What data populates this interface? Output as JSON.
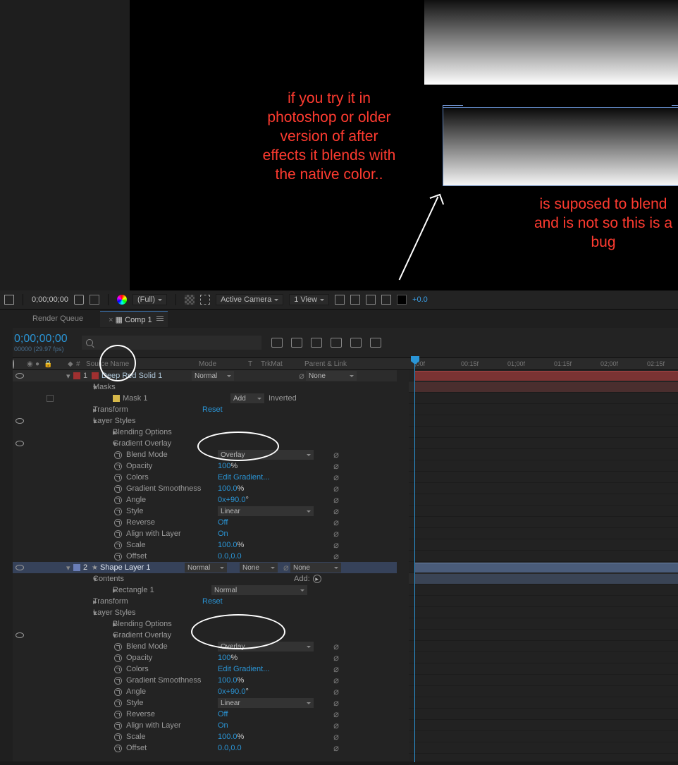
{
  "annotations": {
    "text1": "if you try it in photoshop or older version of after effects it blends with the native color..",
    "text2": "is suposed to blend and is not so this is a bug"
  },
  "toolbar": {
    "time": "0;00;00;00",
    "resolution": "(Full)",
    "camera": "Active Camera",
    "views": "1 View",
    "exposure": "+0.0"
  },
  "tabs": {
    "render_queue": "Render Queue",
    "comp": "Comp 1"
  },
  "timecode": {
    "main": "0;00;00;00",
    "sub": "00000 (29.97 fps)"
  },
  "ruler": {
    "marks": [
      ";00f",
      "00:15f",
      "01;00f",
      "01:15f",
      "02;00f",
      "02:15f"
    ]
  },
  "headers": {
    "source_name": "Source Name",
    "mode": "Mode",
    "t": "T",
    "trkmat": "TrkMat",
    "parent": "Parent & Link"
  },
  "layer1": {
    "num": "1",
    "name": "Deep Red Solid 1",
    "mode": "Normal",
    "parent": "None",
    "masks": "Masks",
    "mask1": "Mask 1",
    "mask_mode": "Add",
    "mask_inverted": "Inverted",
    "transform": "Transform",
    "transform_reset": "Reset",
    "layer_styles": "Layer Styles",
    "blending_options": "Blending Options",
    "gradient_overlay": "Gradient Overlay",
    "props": {
      "blend_mode": {
        "label": "Blend Mode",
        "value": "Overlay"
      },
      "opacity": {
        "label": "Opacity",
        "value": "100",
        "suffix": "%"
      },
      "colors": {
        "label": "Colors",
        "value": "Edit Gradient..."
      },
      "gradient_smoothness": {
        "label": "Gradient Smoothness",
        "value": "100.0",
        "suffix": "%"
      },
      "angle": {
        "label": "Angle",
        "value": "0x+90.0",
        "suffix": "°"
      },
      "style": {
        "label": "Style",
        "value": "Linear"
      },
      "reverse": {
        "label": "Reverse",
        "value": "Off"
      },
      "align": {
        "label": "Align with Layer",
        "value": "On"
      },
      "scale": {
        "label": "Scale",
        "value": "100.0",
        "suffix": "%"
      },
      "offset": {
        "label": "Offset",
        "value": "0.0,0.0"
      }
    }
  },
  "layer2": {
    "num": "2",
    "name": "Shape Layer 1",
    "mode": "Normal",
    "trkmat": "None",
    "parent": "None",
    "contents": "Contents",
    "contents_add": "Add:",
    "rectangle": "Rectangle 1",
    "rect_mode": "Normal",
    "transform": "Transform",
    "transform_reset": "Reset",
    "layer_styles": "Layer Styles",
    "blending_options": "Blending Options",
    "gradient_overlay": "Gradient Overlay",
    "props": {
      "blend_mode": {
        "label": "Blend Mode",
        "value": "Overlay"
      },
      "opacity": {
        "label": "Opacity",
        "value": "100",
        "suffix": "%"
      },
      "colors": {
        "label": "Colors",
        "value": "Edit Gradient..."
      },
      "gradient_smoothness": {
        "label": "Gradient Smoothness",
        "value": "100.0",
        "suffix": "%"
      },
      "angle": {
        "label": "Angle",
        "value": "0x+90.0",
        "suffix": "°"
      },
      "style": {
        "label": "Style",
        "value": "Linear"
      },
      "reverse": {
        "label": "Reverse",
        "value": "Off"
      },
      "align": {
        "label": "Align with Layer",
        "value": "On"
      },
      "scale": {
        "label": "Scale",
        "value": "100.0",
        "suffix": "%"
      },
      "offset": {
        "label": "Offset",
        "value": "0.0,0.0"
      }
    }
  }
}
